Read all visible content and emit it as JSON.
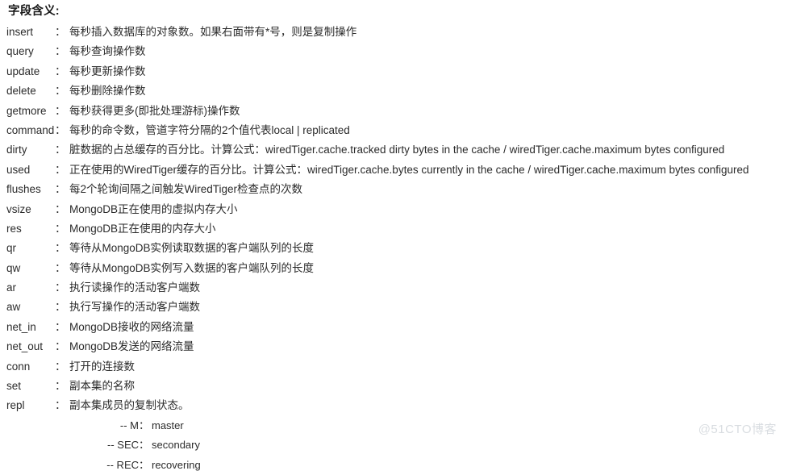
{
  "document": {
    "title": "字段含义:",
    "fields": [
      {
        "label": "insert",
        "sep": "：",
        "desc": "每秒插入数据库的对象数。如果右面带有*号，则是复制操作"
      },
      {
        "label": "query",
        "sep": "：",
        "desc": "每秒查询操作数"
      },
      {
        "label": "update",
        "sep": "：",
        "desc": "每秒更新操作数"
      },
      {
        "label": "delete",
        "sep": "：",
        "desc": "每秒删除操作数"
      },
      {
        "label": "getmore",
        "sep": "：",
        "desc": "每秒获得更多(即批处理游标)操作数"
      },
      {
        "label": "command",
        "sep": "：",
        "desc": "每秒的命令数，管道字符分隔的2个值代表local | replicated"
      },
      {
        "label": "dirty",
        "sep": "：",
        "desc": "脏数据的占总缓存的百分比。计算公式：wiredTiger.cache.tracked dirty bytes in the cache / wiredTiger.cache.maximum bytes configured"
      },
      {
        "label": "used",
        "sep": "：",
        "desc": "正在使用的WiredTiger缓存的百分比。计算公式：wiredTiger.cache.bytes currently in the cache / wiredTiger.cache.maximum bytes configured"
      },
      {
        "label": "flushes",
        "sep": "：",
        "desc": "每2个轮询间隔之间触发WiredTiger检查点的次数"
      },
      {
        "label": "vsize",
        "sep": "：",
        "desc": "MongoDB正在使用的虚拟内存大小"
      },
      {
        "label": "res",
        "sep": "：",
        "desc": "MongoDB正在使用的内存大小"
      },
      {
        "label": "qr",
        "sep": "：",
        "desc": "等待从MongoDB实例读取数据的客户端队列的长度"
      },
      {
        "label": "qw",
        "sep": "：",
        "desc": "等待从MongoDB实例写入数据的客户端队列的长度"
      },
      {
        "label": "ar",
        "sep": "：",
        "desc": "执行读操作的活动客户端数"
      },
      {
        "label": "aw",
        "sep": "：",
        "desc": "执行写操作的活动客户端数"
      },
      {
        "label": "net_in",
        "sep": "：",
        "desc": "MongoDB接收的网络流量"
      },
      {
        "label": "net_out",
        "sep": "：",
        "desc": "MongoDB发送的网络流量"
      },
      {
        "label": "conn",
        "sep": "：",
        "desc": "打开的连接数"
      },
      {
        "label": "set",
        "sep": "：",
        "desc": "副本集的名称"
      },
      {
        "label": "repl",
        "sep": "：",
        "desc": "副本集成员的复制状态。"
      }
    ],
    "repl_states": [
      {
        "code": "-- M",
        "sep": "：",
        "value": "master"
      },
      {
        "code": "-- SEC",
        "sep": "：",
        "value": "secondary"
      },
      {
        "code": "-- REC",
        "sep": "：",
        "value": "recovering"
      }
    ]
  },
  "watermark": {
    "text": "@51CTO博客",
    "color": "#d9dde1"
  }
}
